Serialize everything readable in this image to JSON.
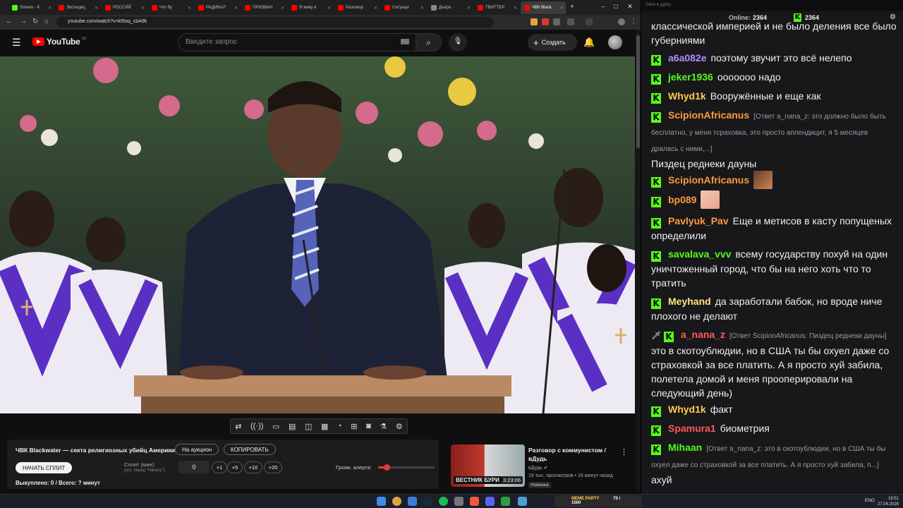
{
  "browser": {
    "tabs": [
      {
        "label": "Stream - K",
        "color": "#53fc18"
      },
      {
        "label": "Экспедиц",
        "color": "#ff0000"
      },
      {
        "label": "РОССИЙ",
        "color": "#ff0000"
      },
      {
        "label": "Что бу",
        "color": "#ff0000"
      },
      {
        "label": "РАДИКАЛ",
        "color": "#ff0000"
      },
      {
        "label": "ПРИЗВАН",
        "color": "#ff0000"
      },
      {
        "label": "Я живу в",
        "color": "#ff0000"
      },
      {
        "label": "Разговор",
        "color": "#ff0000"
      },
      {
        "label": "Ситуаци",
        "color": "#ff0000"
      },
      {
        "label": "Дьяра",
        "color": "#888888"
      },
      {
        "label": "ТВИТТЕР",
        "color": "#ff0000"
      },
      {
        "label": "ЧВК Black",
        "color": "#ff0000"
      }
    ],
    "new_tab_label": "+",
    "url": "youtube.com/watch?v=kt5oq_cbA9k"
  },
  "youtube": {
    "logo_text": "YouTube",
    "region": "LV",
    "search_placeholder": "Введите запрос",
    "create_label": "Создать"
  },
  "video_tools": {
    "icons": [
      "loop-icon",
      "broadcast-icon",
      "screenshare-icon",
      "film-icon",
      "pip-icon",
      "frames-icon",
      "speed-icon",
      "add-clip-icon",
      "camera-icon",
      "lab-icon",
      "settings-icon"
    ]
  },
  "panel": {
    "title": "ЧВК Blackwater — секта религиозных убийц Америки!",
    "auction_label": "На аукцион",
    "copy_label": "КОПИРОВАТЬ",
    "start_split_label": "НАЧАТЬ СПЛИТ",
    "split_label": "Сплит (мин):",
    "split_hint": "(уст. перед \"Начать\")",
    "split_value": "0",
    "steps": [
      "+1",
      "+5",
      "+10",
      "+20"
    ],
    "alert_label": "Громк. алерта:",
    "alert_volume": 0.15,
    "stats": "Выкуплено: 0 / Всего: ? минут"
  },
  "recommended": {
    "title": "Разговор с коммунистом / вДудь",
    "channel": "вДудь",
    "meta": "19 тыс. просмотров • 16 минут назад",
    "badge": "Новинка",
    "thumb_caption": "ВЕСТНИК БУРИ",
    "duration": "3:23:06"
  },
  "chat": {
    "window_title": "Окно в дурку",
    "online_label": "Online:",
    "online_count": "2364",
    "kick_count": "2364",
    "messages": [
      {
        "user": "",
        "color": "#efeff1",
        "text": "классической империей и не было деления все было губерниями",
        "reply": ""
      },
      {
        "user": "a6a082e",
        "color": "#b08cff",
        "text": "поэтому звучит это всё нелепо",
        "reply": ""
      },
      {
        "user": "jeker1936",
        "color": "#53fc18",
        "text": "ооооооо надо",
        "reply": ""
      },
      {
        "user": "Whyd1k",
        "color": "#ffcc4d",
        "text": "Вооружённые и еще как",
        "reply": ""
      },
      {
        "user": "ScipionAfricanus",
        "color": "#ff9a3c",
        "text": "Пиздец реднеки дауны",
        "reply": "[Ответ a_nana_z: это должно было быть бесплатно, у меня тсрахо­вка, это просто аппендицит, я 5 месяцев дралась с ними,...]"
      },
      {
        "user": "ScipionAfricanus",
        "color": "#ff9a3c",
        "text": "",
        "reply": ""
      },
      {
        "user": "bp089",
        "color": "#ff9a3c",
        "text": "",
        "reply": ""
      },
      {
        "user": "Pavlyuk_Pav",
        "color": "#ff9a3c",
        "text": "Еще и метисов в касту попущеных определили",
        "reply": ""
      },
      {
        "user": "savalava_vvv",
        "color": "#53fc18",
        "text": "всему государству похуй на один уничтоженный город, что бы на него хоть что то тратить",
        "reply": ""
      },
      {
        "user": "Meyhand",
        "color": "#ffe680",
        "text": "да заработали бабок, но вроде ниче плохого не делают",
        "reply": ""
      },
      {
        "user": "a_nana_z",
        "color": "#ff5a5a",
        "text": "это в скотоублюдии, но в США ты бы охуел даже со страховкой за все платить. А я просто хуй забила, полетела домой и меня прооперировали на следующий день)",
        "reply": "[Ответ ScipionAfricanus: Пиздец реднеки дауны]"
      },
      {
        "user": "Whyd1k",
        "color": "#ffcc4d",
        "text": "факт",
        "reply": ""
      },
      {
        "user": "Spamura1",
        "color": "#ff5a5a",
        "text": "биометрия",
        "reply": ""
      },
      {
        "user": "Mihaan",
        "color": "#53fc18",
        "text": "ахуй",
        "reply": "[Ответ a_nana_z: это в скотоублюдии, но в США ты бы охуел даже со страховкой за все платить. А я просто хуй забила, п...]"
      }
    ]
  },
  "taskbar": {
    "meme_label": "MEME PARTY",
    "meme_count": "75 / 1500",
    "lang": "ENG",
    "time": "19:51",
    "date": "27.04.2026"
  }
}
